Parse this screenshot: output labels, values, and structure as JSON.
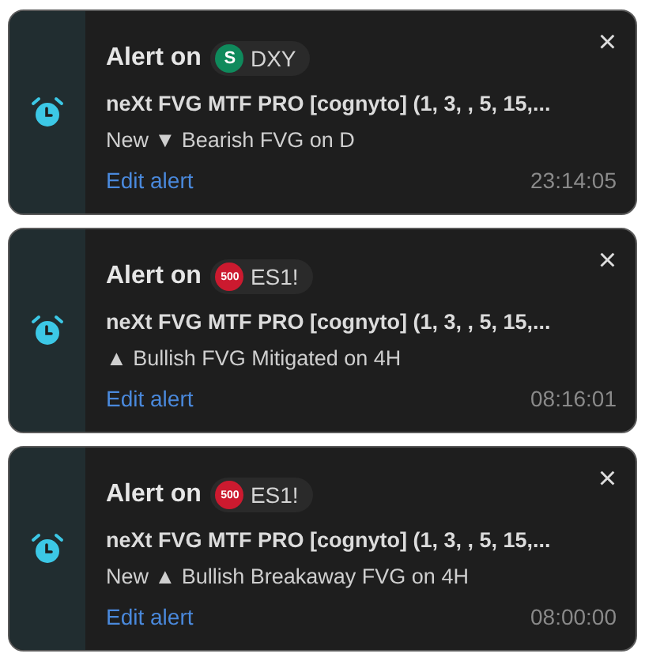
{
  "alerts": [
    {
      "title": "Alert on",
      "symbol": {
        "logo_text": "S",
        "color": "#0f8a5c",
        "ticker": "DXY"
      },
      "close": "×",
      "name": "neXt FVG MTF PRO [cognyto] (1, 3, , 5, 15,...",
      "message": "New ▼ Bearish FVG on D",
      "action": "Edit alert",
      "time": "23:14:05"
    },
    {
      "title": "Alert on",
      "symbol": {
        "logo_text": "500",
        "color": "#cc1a2f",
        "ticker": "ES1!"
      },
      "close": "×",
      "name": "neXt FVG MTF PRO [cognyto] (1, 3, , 5, 15,...",
      "message": "▲ Bullish FVG Mitigated on 4H",
      "action": "Edit alert",
      "time": "08:16:01"
    },
    {
      "title": "Alert on",
      "symbol": {
        "logo_text": "500",
        "color": "#cc1a2f",
        "ticker": "ES1!"
      },
      "close": "×",
      "name": "neXt FVG MTF PRO [cognyto] (1, 3, , 5, 15,...",
      "message": "New ▲ Bullish Breakaway FVG on 4H",
      "action": "Edit alert",
      "time": "08:00:00"
    }
  ]
}
